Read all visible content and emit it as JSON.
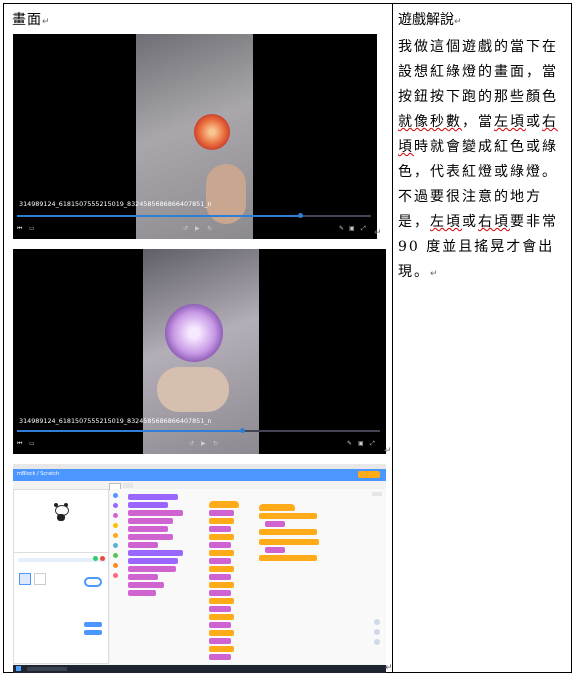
{
  "doc": {
    "left_header": "畫面",
    "explain_title": "遊戲解說",
    "explain_lines": [
      [
        "我做這個遊戲的當下在",
        false
      ],
      [
        "設想紅綠燈的畫面，當",
        false
      ],
      [
        "按鈕按下跑的那些顏色",
        false
      ]
    ],
    "line4_a": "就像秒數",
    "line4_b": "，當",
    "line4_c": "左頃",
    "line4_d": "或",
    "line4_e": "右",
    "line5_a": "頃",
    "line5_b": "時就會變成紅色或綠",
    "line6": "色，代表紅燈或綠燈。",
    "line7": "不過要很注意的地方",
    "line8_a": "是，",
    "line8_b": "左頃",
    "line8_c": "或",
    "line8_d": "右頃",
    "line8_e": "要非常",
    "line9": "90 度並且搖晃才會出",
    "line10": "現。"
  },
  "shots": {
    "video1_filename": "314989124_618150755521501​9_8324585686866407851_n",
    "video2_filename": "314989124_618150755521501​9_8324585686866407851_n",
    "video1_progress": 0.8,
    "video2_progress": 0.62,
    "scratch_brand": "mBlock / Scratch"
  },
  "colors": {
    "video_bg": "#000000",
    "progress": "#2f7fd6",
    "scratch_blue": "#4c97ff",
    "block_orange": "#ffab19",
    "block_purple": "#9966ff",
    "block_magenta": "#cf63cf",
    "typo_underline": "#d40000"
  }
}
